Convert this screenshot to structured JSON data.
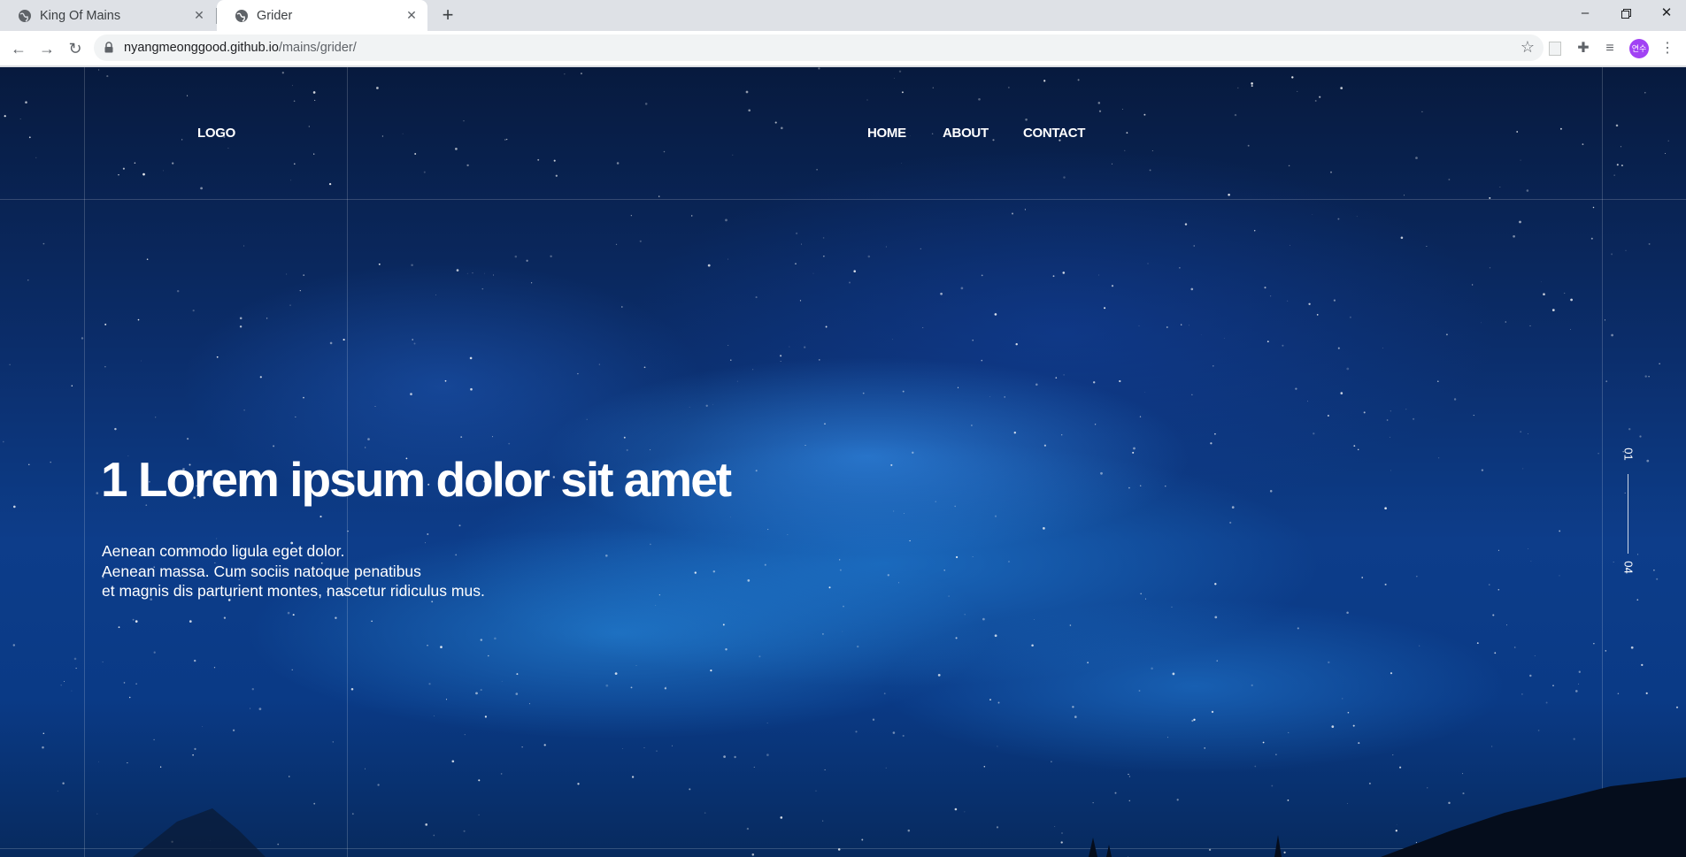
{
  "browser": {
    "tabs": [
      {
        "title": "King Of Mains",
        "active": false
      },
      {
        "title": "Grider",
        "active": true
      }
    ],
    "url_host": "nyangmeonggood.github.io",
    "url_path": "/mains/grider/",
    "avatar_text": "연수"
  },
  "site": {
    "logo": "LOGO",
    "nav": {
      "home": "HOME",
      "about": "ABOUT",
      "contact": "CONTACT"
    },
    "hero": {
      "title": "1 Lorem ipsum dolor sit amet",
      "lines": [
        "Aenean commodo ligula eget dolor.",
        "Aenean massa. Cum sociis natoque penatibus",
        "et magnis dis parturient montes, nascetur ridiculus mus."
      ]
    },
    "pager": {
      "current": "01",
      "total": "04"
    }
  },
  "colors": {
    "sky_dark": "#071a3e",
    "sky_bright": "#2a8cf0",
    "text": "#ffffff"
  }
}
